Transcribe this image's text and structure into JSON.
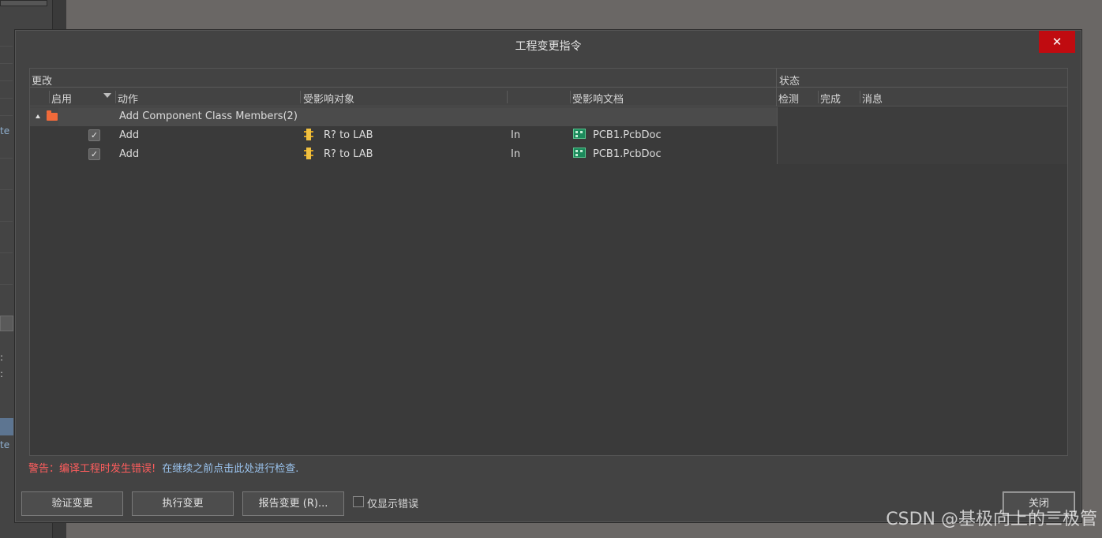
{
  "background": {
    "fragments": [
      "te",
      ":",
      ":",
      "te"
    ]
  },
  "dialog": {
    "title": "工程变更指令",
    "close_icon": "✕"
  },
  "grid": {
    "group_headers": {
      "changes": "更改",
      "status": "状态"
    },
    "columns": {
      "enable": "启用",
      "action": "动作",
      "affected_object": "受影响对象",
      "affected_document": "受影响文档",
      "check": "检测",
      "done": "完成",
      "message": "消息"
    },
    "group_row": {
      "label": "Add Component Class Members(2)"
    },
    "rows": [
      {
        "checked": "✓",
        "action": "Add",
        "object": "R? to LAB",
        "direction": "In",
        "document": "PCB1.PcbDoc"
      },
      {
        "checked": "✓",
        "action": "Add",
        "object": "R? to LAB",
        "direction": "In",
        "document": "PCB1.PcbDoc"
      }
    ]
  },
  "warning": {
    "error_text": "警告：编译工程时发生错误!",
    "hint_text": "在继续之前点击此处进行检查."
  },
  "buttons": {
    "validate": "验证变更",
    "execute": "执行变更",
    "report": "报告变更 (R)...",
    "only_errors": "仅显示错误",
    "close": "关闭"
  },
  "watermark": "CSDN @基极向上的三极管",
  "colors": {
    "close_red": "#c00b10",
    "warning_red": "#ff5d5d",
    "link_blue": "#9bc4ef",
    "folder_orange": "#f06a3a"
  }
}
